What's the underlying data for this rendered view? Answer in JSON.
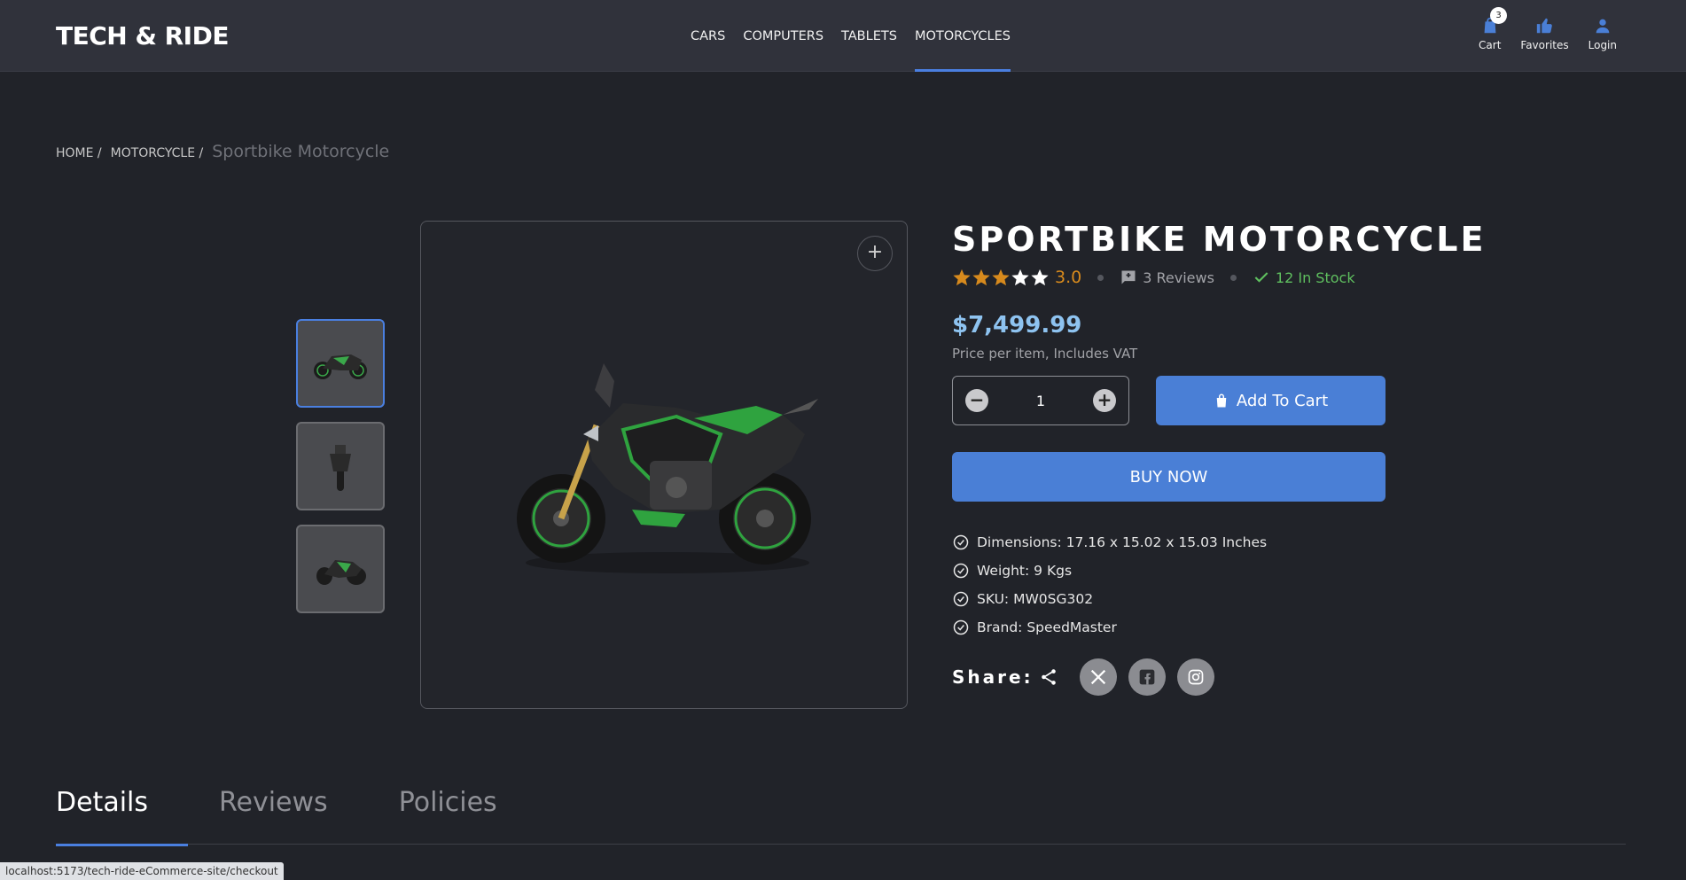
{
  "header": {
    "logo": "TECH & RIDE",
    "nav": [
      "CARS",
      "COMPUTERS",
      "TABLETS",
      "MOTORCYCLES"
    ],
    "active_nav": "MOTORCYCLES",
    "cart_label": "Cart",
    "cart_count": "3",
    "favorites_label": "Favorites",
    "login_label": "Login"
  },
  "breadcrumb": {
    "home": "HOME /",
    "category": "MOTORCYCLE /",
    "current": "Sportbike Motorcycle"
  },
  "gallery": {
    "zoom_symbol": "+"
  },
  "product": {
    "title": "SPORTBIKE MOTORCYCLE",
    "rating": 3,
    "rating_text": "3.0",
    "reviews_text": "3 Reviews",
    "stock_text": "12 In Stock",
    "price": "$7,499.99",
    "price_note": "Price per item, Includes VAT",
    "quantity": "1",
    "add_to_cart": "Add To Cart",
    "buy_now": "BUY NOW",
    "specs": [
      "Dimensions: 17.16 x 15.02 x 15.03 Inches",
      "Weight: 9 Kgs",
      "SKU: MW0SG302",
      "Brand: SpeedMaster"
    ],
    "share_label": "Share:"
  },
  "tabs": [
    "Details",
    "Reviews",
    "Policies"
  ],
  "active_tab": "Details",
  "status_url": "localhost:5173/tech-ride-eCommerce-site/checkout",
  "colors": {
    "accent": "#4a7fd6",
    "price": "#8ec3f0",
    "rating": "#d78a1d",
    "stock": "#5fbf5f"
  }
}
